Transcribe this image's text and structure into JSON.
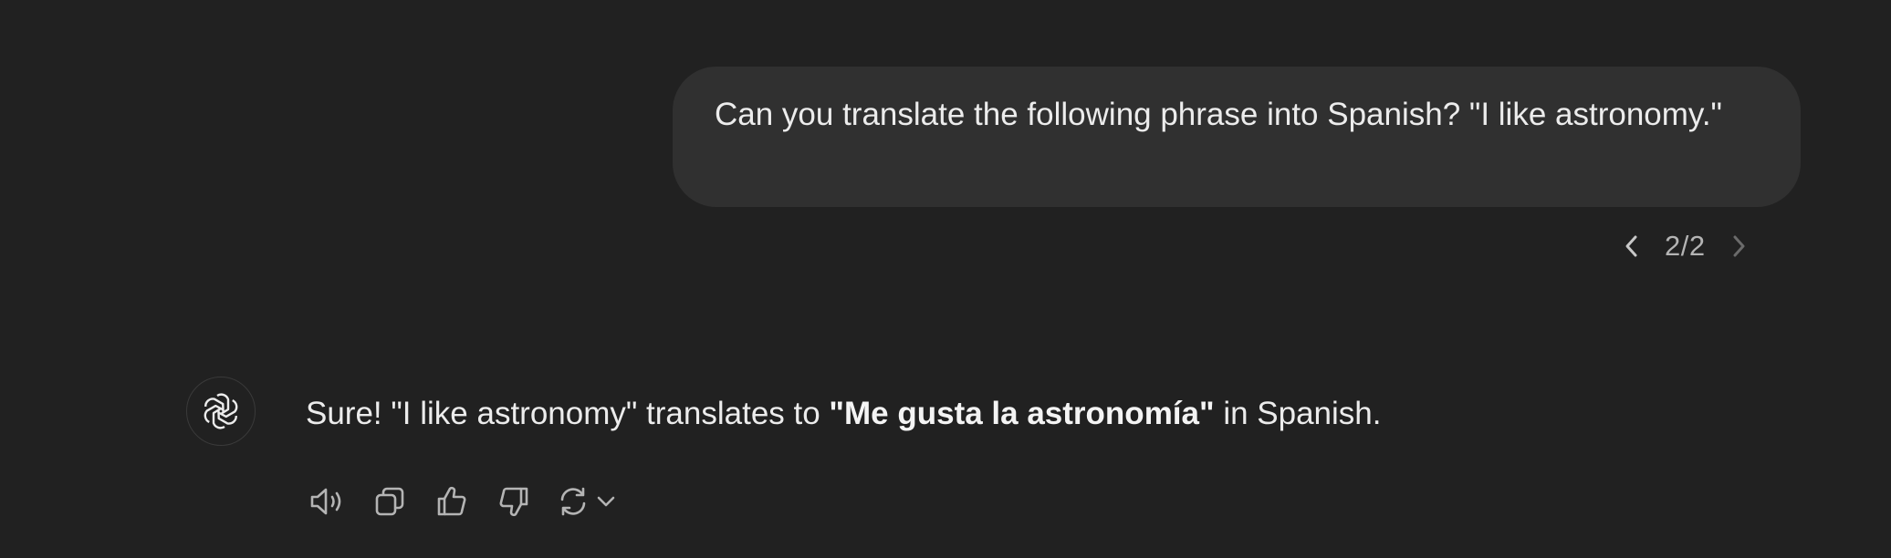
{
  "user_message": {
    "text": "Can you translate the following phrase into Spanish? \"I like astronomy.\""
  },
  "pager": {
    "current": "2/2",
    "prev_icon": "chevron-left-icon",
    "next_icon": "chevron-right-icon"
  },
  "assistant_message": {
    "avatar_icon": "openai-logo-icon",
    "prefix": "Sure! \"I like astronomy\" translates to ",
    "bold": "\"Me gusta la astronomía\"",
    "suffix": " in Spanish."
  },
  "actions": [
    {
      "icon": "speaker-icon"
    },
    {
      "icon": "copy-icon"
    },
    {
      "icon": "thumbs-up-icon"
    },
    {
      "icon": "thumbs-down-icon"
    },
    {
      "icon": "regenerate-icon"
    },
    {
      "icon": "chevron-down-icon"
    }
  ],
  "colors": {
    "background": "#212121",
    "user_bubble": "#303030",
    "text": "#ececec",
    "muted": "#b4b4b4",
    "icon": "#b4b4b4",
    "disabled_icon": "#6b6b6b"
  }
}
